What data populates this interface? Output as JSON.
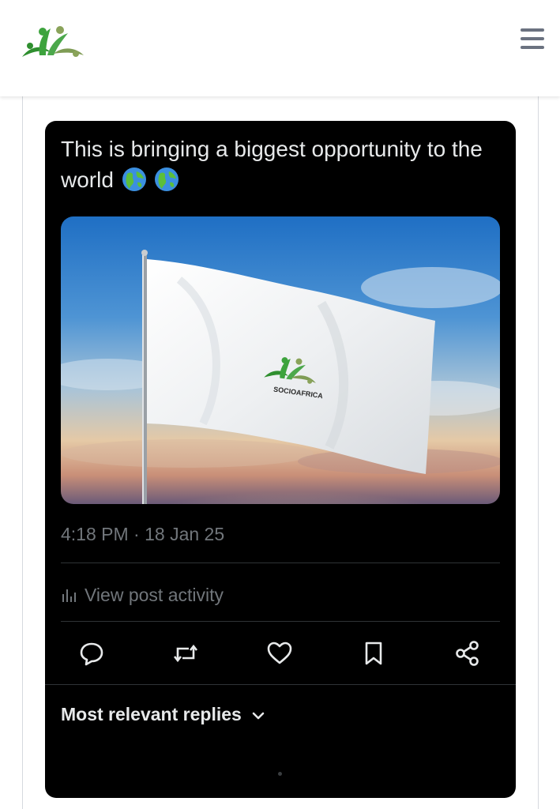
{
  "header": {
    "logo_icon": "socioafrica-people-logo-icon",
    "menu_icon": "hamburger-menu-icon"
  },
  "post": {
    "text": "This is bringing a biggest opportunity to the world",
    "emoji_icons": [
      "globe-americas-icon",
      "globe-americas-icon"
    ],
    "media": {
      "flag_label": "SOCIOAFRICA",
      "logo_icon": "socioafrica-people-logo-icon"
    },
    "timestamp": "4:18 PM · 18 Jan 25",
    "activity_label": "View post activity",
    "activity_icon": "bar-chart-icon",
    "actions": [
      {
        "name": "reply-button",
        "icon": "speech-bubble-icon"
      },
      {
        "name": "repost-button",
        "icon": "repost-arrows-icon"
      },
      {
        "name": "like-button",
        "icon": "heart-icon"
      },
      {
        "name": "bookmark-button",
        "icon": "bookmark-icon"
      },
      {
        "name": "share-button",
        "icon": "share-nodes-icon"
      }
    ],
    "replies_sort_label": "Most relevant replies",
    "replies_sort_icon": "chevron-down-icon"
  },
  "colors": {
    "card_background": "#000000",
    "primary_text": "#e7e9ea",
    "secondary_text": "#71767b",
    "divider": "#2f3336",
    "brand_green": "#3a9a3a",
    "brand_olive": "#7a9a4a"
  }
}
